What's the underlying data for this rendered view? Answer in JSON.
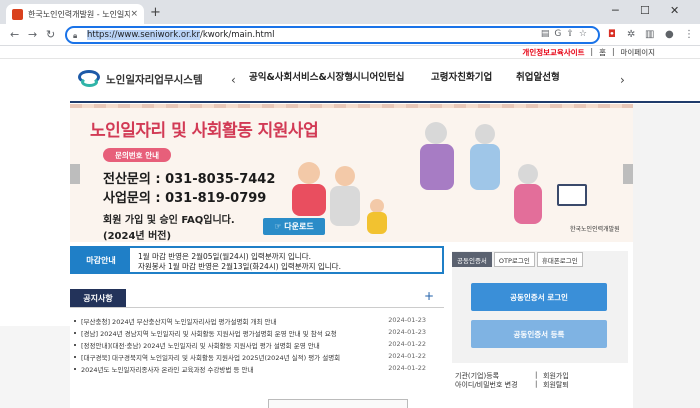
{
  "browser": {
    "tab_title": "한국노인인력개발원 - 노인일자",
    "tab_close": "×",
    "new_tab": "+",
    "url_highlight": "https://www.seniwork.or.kr",
    "url_rest": "/kwork/main.html"
  },
  "top_links": {
    "privacy": "개인정보교육사이트",
    "sep1": "|",
    "home": "홈",
    "sep2": "|",
    "mypage": "마이페이지"
  },
  "logo": {
    "text": "노인일자리업무시스템"
  },
  "gnb": {
    "prev": "‹",
    "next": "›",
    "items": [
      "공익&사회서비스&시장형",
      "시니어인턴십",
      "고령자친화기업",
      "취업알선형"
    ]
  },
  "banner": {
    "title": "노인일자리 및 사회활동 지원사업",
    "pill": "문의번호 안내",
    "call1": "전산문의 : 031-8035-7442",
    "call2": "사업문의 : 031-819-0799",
    "faq": "회원 가입 및 승인 FAQ입니다.",
    "version": "(2024년 버전)",
    "download": "☞ 다운로드",
    "org": "한국노인인력개발원"
  },
  "deadline": {
    "label": "마감안내",
    "line1": "1월 마감 반영은 2월05일(월24시) 입력분까지 입니다.",
    "line2": "자원봉사 1월 마감 반영은 2월13일(화24시) 입력분까지 입니다."
  },
  "notice": {
    "title": "공지사항",
    "more": "+",
    "items": [
      {
        "text": "[부산충청] 2024년 부산충산지역 노인일자리사업 평가설명회 개최 안내",
        "date": "2024-01-23"
      },
      {
        "text": "[경남] 2024년 경남지역 노인일자리 및 사회활동 지원사업 평가설명회 운영 안내 및 참석 요청",
        "date": "2024-01-23"
      },
      {
        "text": "[정정안내](대전·충남) 2024년 노인일자리 및 사회활동 지원사업 평가 설명회 운영 안내",
        "date": "2024-01-22"
      },
      {
        "text": "[대구경북] 대구경북지역 노인일자리 및 사회활동 지원사업 2025년(2024년 실적) 평가 설명회",
        "date": "2024-01-22"
      },
      {
        "text": "2024년도 노인일자리종사자 온라인 교육과정 수강방법 등 안내",
        "date": "2024-01-22"
      }
    ]
  },
  "login": {
    "tabs": [
      "공동인증서",
      "OTP로그인",
      "휴대폰로그인"
    ],
    "cert_login": "공동인증서 로그인",
    "cert_register": "공동인증서 등록",
    "links": [
      "기관(기업)등록",
      "회원가입",
      "아이디/비밀번호 변경",
      "회원탈퇴"
    ],
    "sep": "|"
  }
}
